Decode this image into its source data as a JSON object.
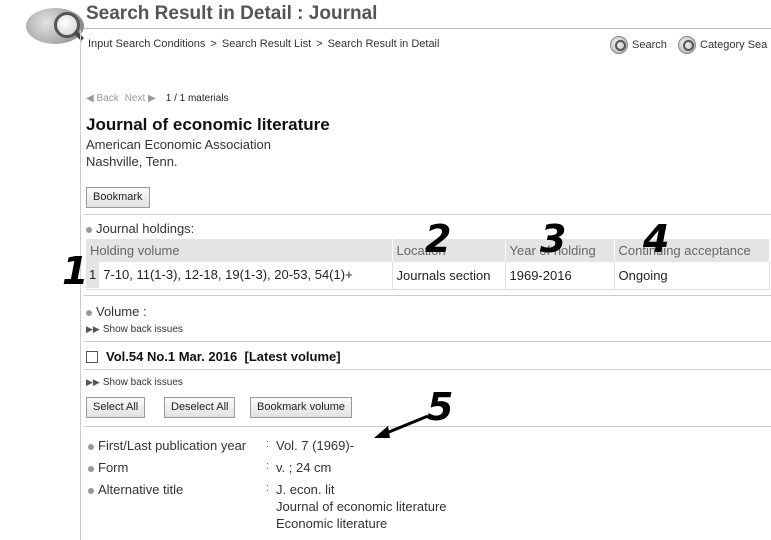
{
  "header": {
    "title": "Search Result in Detail : Journal",
    "breadcrumb": [
      "Input Search Conditions",
      "Search Result List",
      "Search Result in Detail"
    ],
    "breadcrumb_sep": ">",
    "search_btn": "Search",
    "category_btn": "Category Sea"
  },
  "pager": {
    "back": "Back",
    "next": "Next",
    "count": "1 / 1 materials"
  },
  "record": {
    "title": "Journal of economic literature",
    "publisher": "American Economic Association",
    "place": "Nashville, Tenn.",
    "bookmark": "Bookmark"
  },
  "holdings": {
    "label": "Journal holdings:",
    "columns": [
      "Holding volume",
      "Location",
      "Year of holding",
      "Continuing acceptance"
    ],
    "rows": [
      {
        "idx": "1",
        "volume": "7-10, 11(1-3), 12-18, 19(1-3), 20-53, 54(1)+",
        "location": "Journals section",
        "years": "1969-2016",
        "acceptance": "Ongoing"
      }
    ]
  },
  "volume": {
    "label": "Volume :",
    "show_back_1": "Show back issues",
    "latest": "Vol.54 No.1 Mar. 2016  [Latest volume]",
    "show_back_2": "Show back issues",
    "select_all": "Select All",
    "deselect_all": "Deselect All",
    "bookmark_volume": "Bookmark volume"
  },
  "details": [
    {
      "label": "First/Last publication year",
      "values": [
        "Vol. 7 (1969)-"
      ]
    },
    {
      "label": "Form",
      "values": [
        "v. ; 24 cm"
      ]
    },
    {
      "label": "Alternative title",
      "values": [
        "J. econ. lit",
        "Journal of economic literature",
        "Economic literature"
      ]
    }
  ],
  "annotations": [
    "1",
    "2",
    "3",
    "4",
    "5"
  ]
}
